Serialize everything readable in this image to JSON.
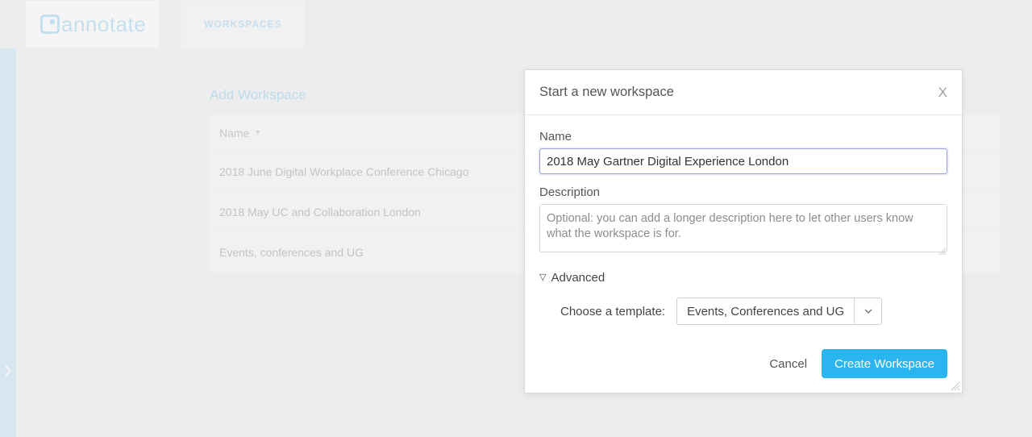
{
  "brand": {
    "name": "annotate"
  },
  "nav": {
    "workspaces_label": "WORKSPACES"
  },
  "page": {
    "title": "Add Workspace",
    "list_header": "Name",
    "rows": [
      {
        "name": "2018 June Digital Workplace Conference Chicago"
      },
      {
        "name": "2018 May UC and Collaboration London"
      },
      {
        "name": "Events, conferences and UG"
      }
    ]
  },
  "modal": {
    "title": "Start a new workspace",
    "close_glyph": "X",
    "name_label": "Name",
    "name_value": "2018 May Gartner Digital Experience London",
    "desc_label": "Description",
    "desc_placeholder": "Optional: you can add a longer description here to let other users know what the workspace is for.",
    "advanced_label": "Advanced",
    "template_label": "Choose a template:",
    "template_value": "Events, Conferences and UG",
    "cancel_label": "Cancel",
    "create_label": "Create Workspace"
  }
}
